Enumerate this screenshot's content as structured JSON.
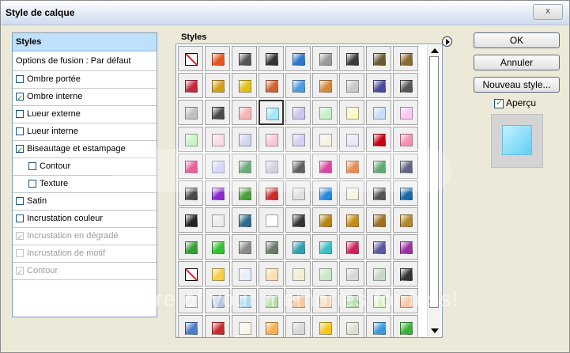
{
  "window": {
    "title": "Style de calque",
    "close_label": "x"
  },
  "left_panel": {
    "header": "Styles",
    "items": [
      {
        "label": "Options de fusion : Par défaut",
        "checkbox": false,
        "checked": false,
        "indent": 0,
        "disabled": false
      },
      {
        "label": "Ombre portée",
        "checkbox": true,
        "checked": false,
        "indent": 0,
        "disabled": false
      },
      {
        "label": "Ombre interne",
        "checkbox": true,
        "checked": true,
        "indent": 0,
        "disabled": false
      },
      {
        "label": "Lueur externe",
        "checkbox": true,
        "checked": false,
        "indent": 0,
        "disabled": false
      },
      {
        "label": "Lueur interne",
        "checkbox": true,
        "checked": false,
        "indent": 0,
        "disabled": false
      },
      {
        "label": "Biseautage et estampage",
        "checkbox": true,
        "checked": true,
        "indent": 0,
        "disabled": false
      },
      {
        "label": "Contour",
        "checkbox": true,
        "checked": false,
        "indent": 1,
        "disabled": false
      },
      {
        "label": "Texture",
        "checkbox": true,
        "checked": false,
        "indent": 1,
        "disabled": false
      },
      {
        "label": "Satin",
        "checkbox": true,
        "checked": false,
        "indent": 0,
        "disabled": false
      },
      {
        "label": "Incrustation couleur",
        "checkbox": true,
        "checked": false,
        "indent": 0,
        "disabled": false
      },
      {
        "label": "Incrustation en dégradé",
        "checkbox": true,
        "checked": true,
        "indent": 0,
        "disabled": true
      },
      {
        "label": "Incrustation de motif",
        "checkbox": true,
        "checked": false,
        "indent": 0,
        "disabled": true
      },
      {
        "label": "Contour",
        "checkbox": true,
        "checked": true,
        "indent": 0,
        "disabled": true
      }
    ]
  },
  "styles_panel": {
    "caption": "Styles",
    "swatches": [
      "none",
      "#e8541c",
      "#555555",
      "#333333",
      "#2a77cc",
      "#9a9a9a",
      "#3c3c3c",
      "#6b5a32",
      "#8a6a30",
      "#c2283c",
      "#d4a01c",
      "#e0c010",
      "#d06030",
      "#4a9ae0",
      "#d48a3a",
      "#c8c8c8",
      "#4a4a9e",
      "#555555",
      "#c0c0c0",
      "#4a4a4a",
      "#f7b4b4",
      "#9fe8f8",
      "#c9c4f0",
      "#c8f0c8",
      "#fafac0",
      "#c8dcfa",
      "#fac8f5",
      "#c8f4c8",
      "#f8dce6",
      "#d0d6f0",
      "#fac8d6",
      "#d4d0f4",
      "#f8f4e4",
      "#e8e8f8",
      "#cc0010",
      "#fa90b0",
      "#e0207a",
      "#c8c8fa",
      "#3a8a4a",
      "#c8c0d8",
      "#222222",
      "#cc0080",
      "#e06010",
      "#228844",
      "#282858",
      "#4a4a4a",
      "#8a28cc",
      "#4aa03a",
      "#cc2a2a",
      "#e0e0e0",
      "#2a8ae0",
      "#f4f4e0",
      "#555555",
      "#1a6aa8",
      "#222222",
      "#ececec",
      "#2a6a8a",
      "#ffffff",
      "#333333",
      "#b88410",
      "#c88a10",
      "#a07020",
      "#b08828",
      "#34a034",
      "#30c030",
      "#8a8a8a",
      "#6a7a6a",
      "#30a0b0",
      "#3ac0c0",
      "#d02060",
      "#5a5aa0",
      "#9a30a0",
      "none",
      "#f8d040",
      "#e8eef8",
      "#fae0b0",
      "#f0f0d0",
      "#c8e8c8",
      "#d8d8d8",
      "#c8d8c8",
      "#333333",
      "#f0f0f0",
      "#b8c8e0",
      "#a8d8f0",
      "#b8e0a8",
      "#f8c8a0",
      "#f8d8b8",
      "#b8e0b0",
      "#e0f0c8",
      "#f8c8a8",
      "#4a7ac8",
      "#c82a2a",
      "#f8f8e8",
      "#f8b050",
      "#d8d8d8",
      "#f8c820",
      "#e0e0d0",
      "#3a9ae0",
      "#38b038",
      "#4a6ac8",
      "#2a8ad0",
      "#d8d8d8",
      "#3a8ae0",
      "#e82a2a",
      "#f8f8c0",
      "#e0e0e0",
      "#2a8a6a",
      "#f8a040"
    ],
    "selected_index": 21
  },
  "buttons": {
    "ok": "OK",
    "cancel": "Annuler",
    "new_style": "Nouveau style..."
  },
  "preview": {
    "label": "Aperçu",
    "checked": true
  },
  "watermark": "Protect more of your memories for less!"
}
